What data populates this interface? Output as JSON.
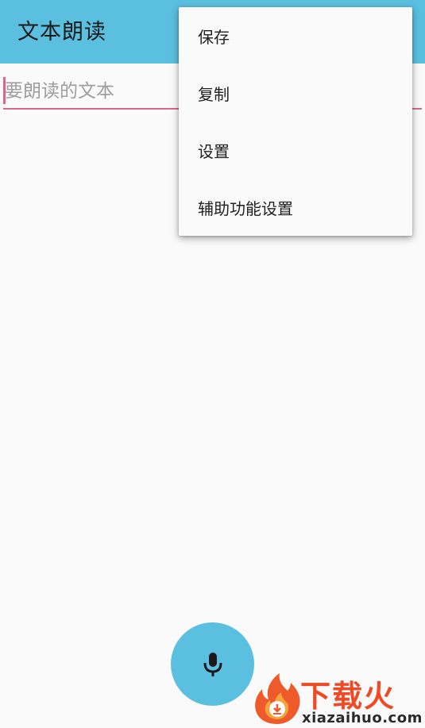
{
  "app": {
    "title": "文本朗读"
  },
  "input": {
    "placeholder": "要朗读的文本",
    "value": ""
  },
  "menu": {
    "items": [
      {
        "label": "保存"
      },
      {
        "label": "复制"
      },
      {
        "label": "设置"
      },
      {
        "label": "辅助功能设置"
      }
    ]
  },
  "fab": {
    "icon": "microphone-icon"
  },
  "watermark": {
    "title": "下载火",
    "url": "xiazaihuo.com"
  },
  "colors": {
    "primary": "#5bbfe0",
    "accent": "#d8668e",
    "watermark": "#ee4b25"
  }
}
